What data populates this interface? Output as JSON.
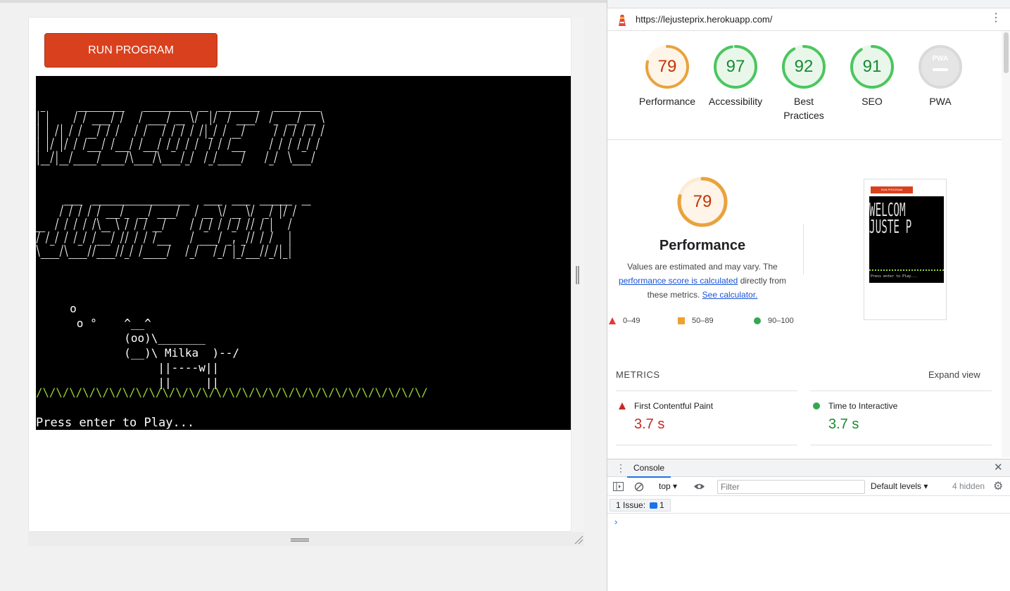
{
  "app": {
    "run_button_label": "RUN PROGRAM",
    "terminal": {
      "banner_lines": [
        " _       __________    __________  __  _________   __________ ",
        "| |     / / ____/ /   / ____/ __ \\/  |/  / ____/  /_  __/ __ \\",
        "| | /| / / __/ / /   / /   / / / / /|_/ / __/      / / / / / /",
        "| |/ |/ / /___/ /___/ /___/ /_/ / /  / / /___     / / / /_/ / ",
        "|__/|__/_____/_____/\\____/\\____/_/  /_/_____/    /_/  \\____/  ",
        "",
        "",
        "      ____  _____________________   ____  ____  _______  __",
        "     / / / / / ___/_  __/ ____/   / __ \\/ __ \\/  _/ |/ /",
        "__  / / / / /\\__ \\ / / / __/     / /_/ / /_/ // / |   / ",
        "/ /_/ / /_/ /___/ // / / /___    / ____/ _, _// / /   |  ",
        "\\____/\\____//____//_/ /_____/   /_/   /_/ |_/___//_/|_|  "
      ],
      "cow_lines": [
        "     o",
        "      o °    ^__^",
        "             (oo)\\_______",
        "             (__)\\ Milka  )--/",
        "                  ||----w||",
        "                  ||     ||"
      ],
      "grass": "/\\/\\/\\/\\/\\/\\/\\/\\/\\/\\/\\/\\/\\/\\/\\/\\/\\/\\/\\/\\/\\/\\/\\/\\/\\/\\/\\/\\/\\/",
      "prompt": "Press enter to Play..."
    }
  },
  "devtools": {
    "url": "https://lejusteprix.herokuapp.com/",
    "scores": [
      {
        "label": "Performance",
        "value": 79,
        "color": "#e8a33d",
        "bg": "#fff4e8",
        "text_color": "#c33300"
      },
      {
        "label": "Accessibility",
        "value": 97,
        "color": "#4cc65e",
        "bg": "#e9f7eb",
        "text_color": "#188a32"
      },
      {
        "label": "Best Practices",
        "value": 92,
        "color": "#4cc65e",
        "bg": "#e9f7eb",
        "text_color": "#188a32"
      },
      {
        "label": "SEO",
        "value": 91,
        "color": "#4cc65e",
        "bg": "#e9f7eb",
        "text_color": "#188a32"
      },
      {
        "label": "PWA",
        "value": null,
        "color": "#d9d9d9",
        "bg": "#e5e5e5",
        "text_color": "#9e9e9e",
        "badge": "PWA"
      }
    ],
    "performance_detail": {
      "score": "79",
      "title": "Performance",
      "desc_start": "Values are estimated and may vary. The",
      "link1": "performance score is calculated",
      "desc_mid": "directly from these metrics.",
      "link2": "See calculator."
    },
    "legend": [
      {
        "range": "0–49",
        "shape": "triangle",
        "color": "#e53935"
      },
      {
        "range": "50–89",
        "shape": "square",
        "color": "#f0a02c"
      },
      {
        "range": "90–100",
        "shape": "circle",
        "color": "#34a853"
      }
    ],
    "metrics_heading": "METRICS",
    "expand_label": "Expand view",
    "metrics": [
      {
        "name": "First Contentful Paint",
        "value": "3.7 s",
        "status": "fail",
        "color": "#c62828"
      },
      {
        "name": "Time to Interactive",
        "value": "3.7 s",
        "status": "pass",
        "color": "#188a32"
      }
    ],
    "console": {
      "tab_label": "Console",
      "context": "top",
      "filter_placeholder": "Filter",
      "levels": "Default levels",
      "hidden": "4 hidden",
      "issues_label": "1 Issue:",
      "issues_count": "1"
    }
  }
}
